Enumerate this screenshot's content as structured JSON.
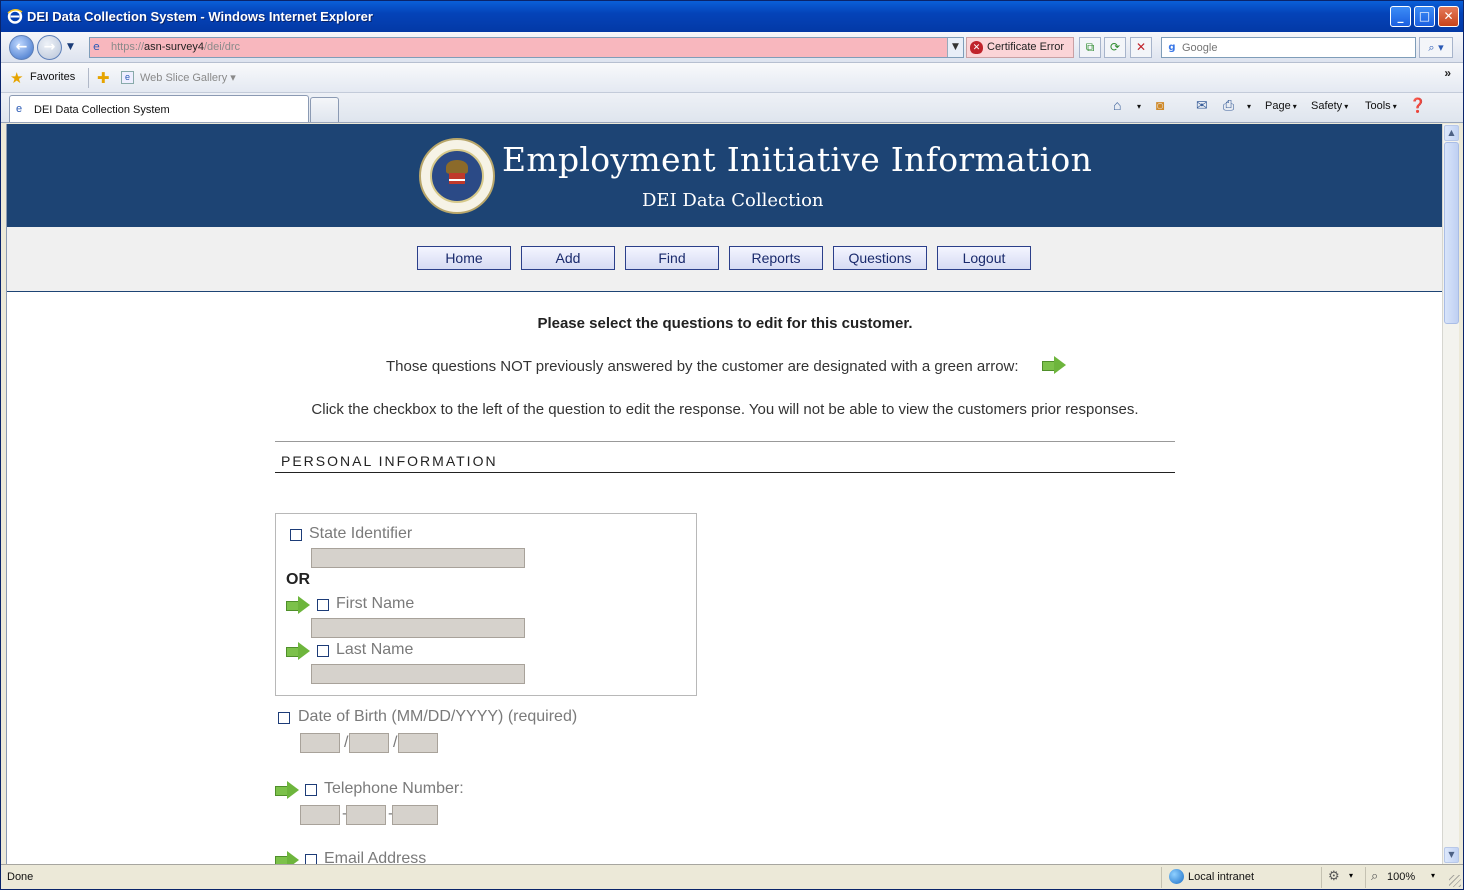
{
  "window": {
    "title": "DEI Data Collection System - Windows Internet Explorer",
    "minimize": "_",
    "maximize": "□",
    "close": "✕"
  },
  "navbar": {
    "url_prefix": "https://",
    "url_host": "asn-survey4",
    "url_path": "/dei/drc",
    "cert_error": "Certificate Error",
    "search_placeholder": "Google"
  },
  "favorites_bar": {
    "favorites_label": "Favorites",
    "web_slice_label": "Web Slice Gallery"
  },
  "tabs": {
    "active_tab_label": "DEI Data Collection System",
    "commands": {
      "page": "Page",
      "safety": "Safety",
      "tools": "Tools"
    }
  },
  "banner": {
    "title": "Employment Initiative Information",
    "subtitle": "DEI Data Collection"
  },
  "menu": {
    "items": [
      "Home",
      "Add",
      "Find",
      "Reports",
      "Questions",
      "Logout"
    ]
  },
  "instructions": {
    "heading": "Please select the questions to edit for this customer.",
    "note_arrow": "Those questions NOT previously answered by the customer are designated with a green arrow:",
    "note_checkbox": "Click the checkbox to the left of the question to edit the response. You will not be able to view the customers prior responses."
  },
  "section": {
    "title": "PERSONAL INFORMATION"
  },
  "fields": {
    "state_identifier": "State Identifier",
    "or_label": "OR",
    "first_name": "First Name",
    "last_name": "Last Name",
    "dob": "Date of Birth (MM/DD/YYYY) (required)",
    "dob_sep": "/",
    "telephone": "Telephone Number:",
    "tel_sep": "-",
    "email": "Email Address"
  },
  "statusbar": {
    "status": "Done",
    "zone": "Local intranet",
    "zoom": "100%"
  }
}
